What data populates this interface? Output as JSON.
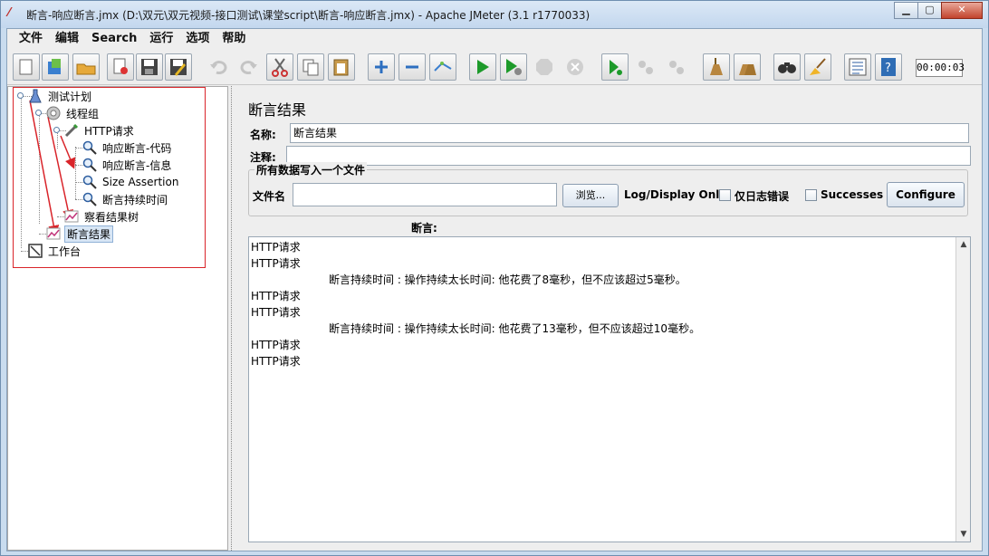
{
  "window": {
    "title": "断言-响应断言.jmx (D:\\双元\\双元视频-接口测试\\课堂script\\断言-响应断言.jmx) - Apache JMeter (3.1 r1770033)",
    "minimize": "▁",
    "maximize": "▢",
    "close": "✕"
  },
  "menubar": [
    "文件",
    "编辑",
    "Search",
    "运行",
    "选项",
    "帮助"
  ],
  "toolbar": {
    "timer": "00:00:03",
    "icons": [
      "new-icon",
      "templates-icon",
      "open-icon",
      "close-icon",
      "save-icon",
      "save-as-icon",
      "undo-icon",
      "redo-icon",
      "cut-icon",
      "copy-icon",
      "paste-icon",
      "expand-icon",
      "collapse-icon",
      "toggle-icon",
      "start-icon",
      "start-no-pause-icon",
      "stop-icon",
      "shutdown-icon",
      "remote-start-icon",
      "remote-stop-icon",
      "remote-shutdown-icon",
      "clear-icon",
      "clear-all-icon",
      "search-icon",
      "reset-search-icon",
      "function-helper-icon",
      "help-icon"
    ]
  },
  "tree": {
    "items": [
      {
        "label": "测试计划",
        "icon": "test-plan-icon"
      },
      {
        "label": "线程组",
        "icon": "thread-group-icon"
      },
      {
        "label": "HTTP请求",
        "icon": "http-request-icon"
      },
      {
        "label": "响应断言-代码",
        "icon": "magnifier-icon"
      },
      {
        "label": "响应断言-信息",
        "icon": "magnifier-icon"
      },
      {
        "label": "Size Assertion",
        "icon": "magnifier-icon"
      },
      {
        "label": "断言持续时间",
        "icon": "magnifier-icon"
      },
      {
        "label": "察看结果树",
        "icon": "listener-icon"
      },
      {
        "label": "断言结果",
        "icon": "listener-icon"
      },
      {
        "label": "工作台",
        "icon": "workbench-icon"
      }
    ]
  },
  "panel": {
    "title": "断言结果",
    "name_label": "名称:",
    "name_value": "断言结果",
    "comment_label": "注释:",
    "comment_value": "",
    "file_group_title": "所有数据写入一个文件",
    "filename_label": "文件名",
    "filename_value": "",
    "browse_button": "浏览...",
    "log_display_label": "Log/Display Only:",
    "errors_only_label": "仅日志错误",
    "successes_label": "Successes",
    "configure_button": "Configure",
    "assertions_header": "断言:",
    "results": [
      "HTTP请求",
      "HTTP请求",
      "            断言持续时间 : 操作持续太长时间: 他花费了8毫秒，但不应该超过5毫秒。",
      "HTTP请求",
      "HTTP请求",
      "            断言持续时间 : 操作持续太长时间: 他花费了13毫秒，但不应该超过10毫秒。",
      "HTTP请求",
      "HTTP请求"
    ]
  }
}
